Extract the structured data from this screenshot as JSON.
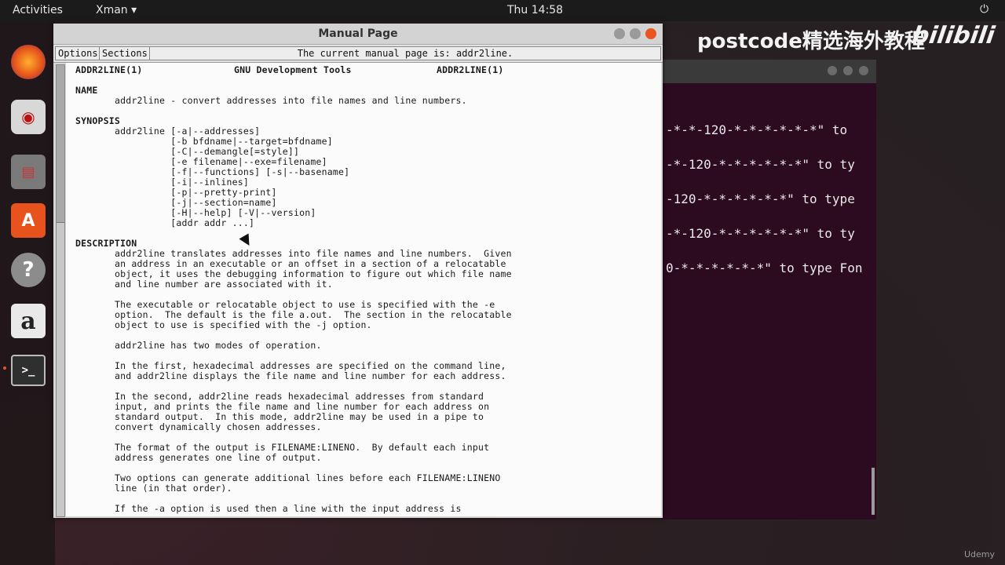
{
  "topbar": {
    "activities": "Activities",
    "app_menu": "Xman ▾",
    "clock": "Thu 14:58",
    "power_icon": "⏻"
  },
  "dock": {
    "items": [
      "firefox-icon",
      "disk-icon",
      "files-icon",
      "software-icon",
      "help-icon",
      "amazon-icon",
      "terminal-icon"
    ],
    "help_glyph": "?",
    "amazon_glyph": "a",
    "terminal_glyph": ">_",
    "store_glyph": "A"
  },
  "watermark": {
    "text": "postcode精选海外教程",
    "logo": "bilibili"
  },
  "udemy": "Udemy",
  "terminal": {
    "lines": [
      "-*-*-120-*-*-*-*-*-*\" to",
      "-*-120-*-*-*-*-*-*\" to ty",
      "-120-*-*-*-*-*-*\" to type",
      "-*-120-*-*-*-*-*-*\" to ty",
      "0-*-*-*-*-*-*\" to type Fon"
    ]
  },
  "manual": {
    "window_title": "Manual Page",
    "options_label": "Options",
    "sections_label": "Sections",
    "current_page": "The current manual page is: addr2line.",
    "header_left": "ADDR2LINE(1)",
    "header_center": "GNU Development Tools",
    "header_right": "ADDR2LINE(1)",
    "name_heading": "NAME",
    "name_text": "addr2line - convert addresses into file names and line numbers.",
    "synopsis_heading": "SYNOPSIS",
    "synopsis": [
      "addr2line [-a|--addresses]",
      "          [-b bfdname|--target=bfdname]",
      "          [-C|--demangle[=style]]",
      "          [-e filename|--exe=filename]",
      "          [-f|--functions] [-s|--basename]",
      "          [-i|--inlines]",
      "          [-p|--pretty-print]",
      "          [-j|--section=name]",
      "          [-H|--help] [-V|--version]",
      "          [addr addr ...]"
    ],
    "description_heading": "DESCRIPTION",
    "description": [
      "addr2line translates addresses into file names and line numbers.  Given",
      "an address in an executable or an offset in a section of a relocatable",
      "object, it uses the debugging information to figure out which file name",
      "and line number are associated with it.",
      "",
      "The executable or relocatable object to use is specified with the -e",
      "option.  The default is the file a.out.  The section in the relocatable",
      "object to use is specified with the -j option.",
      "",
      "addr2line has two modes of operation.",
      "",
      "In the first, hexadecimal addresses are specified on the command line,",
      "and addr2line displays the file name and line number for each address.",
      "",
      "In the second, addr2line reads hexadecimal addresses from standard",
      "input, and prints the file name and line number for each address on",
      "standard output.  In this mode, addr2line may be used in a pipe to",
      "convert dynamically chosen addresses.",
      "",
      "The format of the output is FILENAME:LINENO.  By default each input",
      "address generates one line of output.",
      "",
      "Two options can generate additional lines before each FILENAME:LINENO",
      "line (in that order).",
      "",
      "If the -a option is used then a line with the input address is"
    ]
  }
}
